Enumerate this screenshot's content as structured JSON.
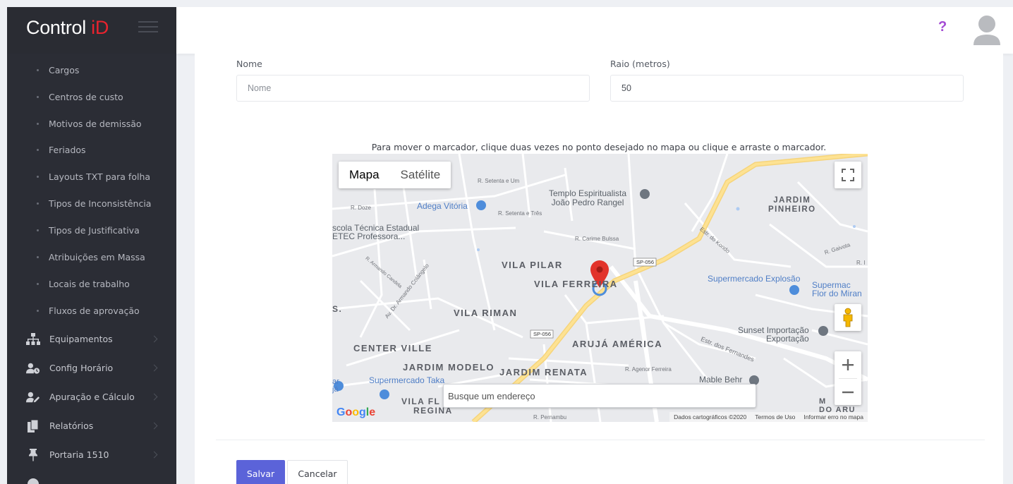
{
  "app": {
    "brand_text": "Control ",
    "brand_accent": "iD",
    "accent_color": "#e8232e",
    "help_label": "?"
  },
  "sidebar": {
    "sub_items": [
      {
        "label": "Cargos"
      },
      {
        "label": "Centros de custo"
      },
      {
        "label": "Motivos de demissão"
      },
      {
        "label": "Feriados"
      },
      {
        "label": "Layouts TXT para folha"
      },
      {
        "label": "Tipos de Inconsistência"
      },
      {
        "label": "Tipos de Justificativa"
      },
      {
        "label": "Atribuições em Massa"
      },
      {
        "label": "Locais de trabalho"
      },
      {
        "label": "Fluxos de aprovação"
      }
    ],
    "main_items": [
      {
        "label": "Equipamentos",
        "icon": "sitemap-icon"
      },
      {
        "label": "Config Horário",
        "icon": "users-clock-icon"
      },
      {
        "label": "Apuração e Cálculo",
        "icon": "user-edit-icon"
      },
      {
        "label": "Relatórios",
        "icon": "copy-icon"
      },
      {
        "label": "Portaria 1510",
        "icon": "thumbtack-icon"
      },
      {
        "label": "",
        "icon": "circle-icon"
      }
    ]
  },
  "form": {
    "name_label": "Nome",
    "name_placeholder": "Nome",
    "name_value": "",
    "radius_label": "Raio (metros)",
    "radius_value": "50",
    "map_hint": "Para mover o marcador, clique duas vezes no ponto desejado no mapa ou clique e arraste o marcador."
  },
  "map": {
    "type_map": "Mapa",
    "type_satellite": "Satélite",
    "search_placeholder": "Busque um endereço",
    "footer_data": "Dados cartográficos ©2020",
    "footer_terms": "Termos de Uso",
    "footer_report": "Informar erro no mapa",
    "google_logo": "Google",
    "labels": {
      "temple": "Templo Espiritualista\nJoão Pedro Rangel",
      "adega": "Adega Vitória",
      "escola": "scola Técnica Estadual\nETEC Professora...",
      "vila_pilar": "VILA PILAR",
      "vila_ferreira": "VILA FERREIRA",
      "vila_riman": "VILA RIMAN",
      "center_ville": "CENTER VILLE",
      "jardim_modelo": "JARDIM MODELO",
      "jardim_renata": "JARDIM RENATA",
      "aruja_america": "ARUJÁ AMÉRICA",
      "jardim_pinheiro": "JARDIM\nPINHEIRO",
      "supermercado_explosao": "Supermercado Explosão",
      "supermercado_flor": "Supermac\nFlor do Miran",
      "sunset": "Sunset Importação\nExportação",
      "supermercado_taka": "Supermercado Taka",
      "mable": "Mable Behr",
      "vila_fl": "VILA FL",
      "regina": "REGINA",
      "sp056a": "SP-056",
      "sp056b": "SP-056",
      "r_doze": "R. Doze",
      "r_setenta_um": "R. Setenta e Um",
      "r_setenta_tres": "R. Setenta e Três",
      "r_carime": "R. Carime Bulssa",
      "estr_kondo": "Estr. do Kondo",
      "r_gaivota": "R. Gaivota",
      "estr_fernandes": "Estr. dos Fernandes",
      "r_agenor": "R. Agenor Ferreira",
      "av_armando": "Av. Dr. Armando Colângelo",
      "r_armando_candela": "R. Armando Candela",
      "r_pernambuco": "R. Pernambu",
      "s_left": "S.",
      "ar_left": "ar\njá",
      "m_right": "M        T\nDO ARU",
      "r_right": "R. I"
    }
  },
  "actions": {
    "save_label": "Salvar",
    "cancel_label": "Cancelar",
    "save_color": "#5b63d9"
  }
}
